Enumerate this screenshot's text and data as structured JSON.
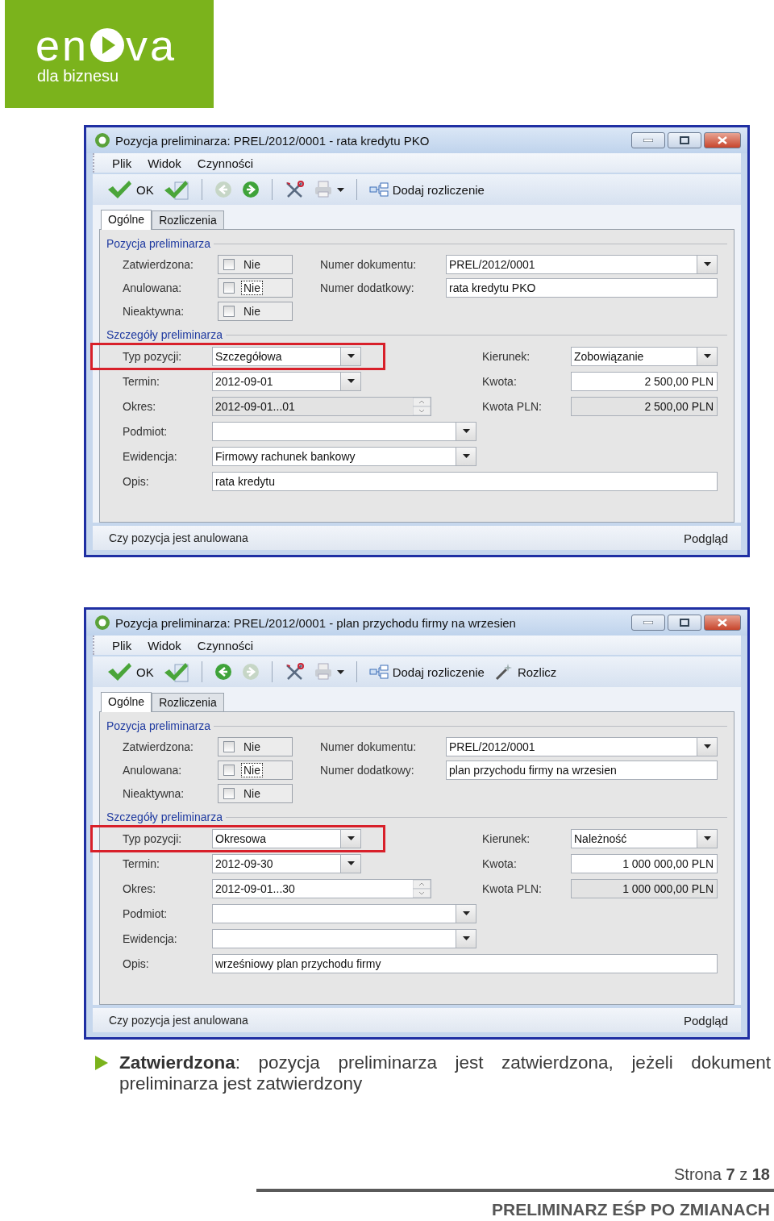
{
  "logo": {
    "brand_start": "en",
    "brand_end": "va",
    "tagline": "dla biznesu"
  },
  "windows": [
    {
      "title": "Pozycja preliminarza: PREL/2012/0001 - rata kredytu PKO",
      "menu": [
        "Plik",
        "Widok",
        "Czynności"
      ],
      "toolbar": [
        {
          "kind": "ok",
          "label": "OK",
          "disabled": false
        },
        {
          "kind": "approve",
          "disabled": false
        },
        {
          "kind": "separator"
        },
        {
          "kind": "back",
          "disabled": true
        },
        {
          "kind": "forward",
          "disabled": false
        },
        {
          "kind": "separator"
        },
        {
          "kind": "tools",
          "disabled": false
        },
        {
          "kind": "print",
          "disabled": true
        },
        {
          "kind": "separator"
        },
        {
          "kind": "add",
          "label": "Dodaj rozliczenie",
          "disabled": false
        }
      ],
      "tabs": [
        {
          "label": "Ogólne",
          "selected": true
        },
        {
          "label": "Rozliczenia",
          "selected": false
        }
      ],
      "group_1": {
        "title": "Pozycja preliminarza",
        "rows": [
          {
            "flag": {
              "label": "Zatwierdzona:",
              "value": "Nie",
              "checked": false,
              "focused": false
            },
            "field": {
              "label": "Numer dokumentu:",
              "kind": "combo",
              "value": "PREL/2012/0001"
            }
          },
          {
            "flag": {
              "label": "Anulowana:",
              "value": "Nie",
              "checked": false,
              "focused": true
            },
            "field": {
              "label": "Numer dodatkowy:",
              "kind": "text",
              "value": "rata kredytu PKO"
            }
          },
          {
            "flag": {
              "label": "Nieaktywna:",
              "value": "Nie",
              "checked": false,
              "focused": false
            }
          }
        ]
      },
      "group_2": {
        "title": "Szczegóły preliminarza",
        "rows": [
          {
            "left": {
              "label": "Typ pozycji:",
              "kind": "combo",
              "value": "Szczegółowa",
              "readonly": false,
              "highlighted": true
            },
            "right": {
              "label": "Kierunek:",
              "kind": "combo",
              "value": "Zobowiązanie",
              "readonly": false
            }
          },
          {
            "left": {
              "label": "Termin:",
              "kind": "combo",
              "value": "2012-09-01",
              "readonly": false,
              "highlighted": false
            },
            "right": {
              "label": "Kwota:",
              "kind": "amount",
              "value": "2 500,00 PLN",
              "readonly": false
            }
          },
          {
            "left": {
              "label": "Okres:",
              "kind": "spin",
              "value": "2012-09-01...01",
              "readonly": true,
              "highlighted": false
            },
            "right": {
              "label": "Kwota PLN:",
              "kind": "amount",
              "value": "2 500,00 PLN",
              "readonly": true
            }
          },
          {
            "left": {
              "label": "Podmiot:",
              "kind": "lookup",
              "readonly": false,
              "highlighted": false
            }
          },
          {
            "left": {
              "label": "Ewidencja:",
              "kind": "lookup",
              "value": "Firmowy rachunek bankowy",
              "readonly": false,
              "highlighted": false
            }
          },
          {
            "left": {
              "label": "Opis:",
              "kind": "text",
              "value": "rata kredytu",
              "readonly": false,
              "highlighted": false
            }
          }
        ]
      },
      "status": {
        "text": "Czy pozycja jest anulowana",
        "action": "Podgląd"
      }
    },
    {
      "title": "Pozycja preliminarza: PREL/2012/0001 - plan przychodu firmy na wrzesien",
      "menu": [
        "Plik",
        "Widok",
        "Czynności"
      ],
      "toolbar": [
        {
          "kind": "ok",
          "label": "OK",
          "disabled": false
        },
        {
          "kind": "approve",
          "disabled": false
        },
        {
          "kind": "separator"
        },
        {
          "kind": "back",
          "disabled": false
        },
        {
          "kind": "forward",
          "disabled": true
        },
        {
          "kind": "separator"
        },
        {
          "kind": "tools",
          "disabled": false
        },
        {
          "kind": "print",
          "disabled": true
        },
        {
          "kind": "separator"
        },
        {
          "kind": "add",
          "label": "Dodaj rozliczenie",
          "disabled": false
        },
        {
          "kind": "settle",
          "label": "Rozlicz",
          "disabled": false
        }
      ],
      "tabs": [
        {
          "label": "Ogólne",
          "selected": true
        },
        {
          "label": "Rozliczenia",
          "selected": false
        }
      ],
      "group_1": {
        "title": "Pozycja preliminarza",
        "rows": [
          {
            "flag": {
              "label": "Zatwierdzona:",
              "value": "Nie",
              "checked": false,
              "focused": false
            },
            "field": {
              "label": "Numer dokumentu:",
              "kind": "combo",
              "value": "PREL/2012/0001"
            }
          },
          {
            "flag": {
              "label": "Anulowana:",
              "value": "Nie",
              "checked": false,
              "focused": true
            },
            "field": {
              "label": "Numer dodatkowy:",
              "kind": "text",
              "value": "plan przychodu firmy na wrzesien"
            }
          },
          {
            "flag": {
              "label": "Nieaktywna:",
              "value": "Nie",
              "checked": false,
              "focused": false
            }
          }
        ]
      },
      "group_2": {
        "title": "Szczegóły preliminarza",
        "rows": [
          {
            "left": {
              "label": "Typ pozycji:",
              "kind": "combo",
              "value": "Okresowa",
              "readonly": false,
              "highlighted": true
            },
            "right": {
              "label": "Kierunek:",
              "kind": "combo",
              "value": "Należność",
              "readonly": false
            }
          },
          {
            "left": {
              "label": "Termin:",
              "kind": "combo",
              "value": "2012-09-30",
              "readonly": false,
              "highlighted": false
            },
            "right": {
              "label": "Kwota:",
              "kind": "amount",
              "value": "1 000 000,00 PLN",
              "readonly": false
            }
          },
          {
            "left": {
              "label": "Okres:",
              "kind": "spin",
              "value": "2012-09-01...30",
              "readonly": false,
              "highlighted": false
            },
            "right": {
              "label": "Kwota PLN:",
              "kind": "amount",
              "value": "1 000 000,00 PLN",
              "readonly": true
            }
          },
          {
            "left": {
              "label": "Podmiot:",
              "kind": "lookup",
              "readonly": false,
              "highlighted": false
            }
          },
          {
            "left": {
              "label": "Ewidencja:",
              "kind": "lookup",
              "readonly": false,
              "highlighted": false
            }
          },
          {
            "left": {
              "label": "Opis:",
              "kind": "text",
              "value": "wrześniowy plan przychodu firmy",
              "readonly": false,
              "highlighted": false
            }
          }
        ]
      },
      "status": {
        "text": "Czy pozycja jest anulowana",
        "action": "Podgląd"
      }
    }
  ],
  "bullets": [
    {
      "text": "**Zatwierdzona**: pozycja preliminarza jest zatwierdzona, jeżeli dokument preliminarza jest zatwierdzony"
    }
  ],
  "footer": {
    "page": "Strona **7** z **18**",
    "title": "PRELIMINARZ EŚP PO ZMIANACH"
  }
}
